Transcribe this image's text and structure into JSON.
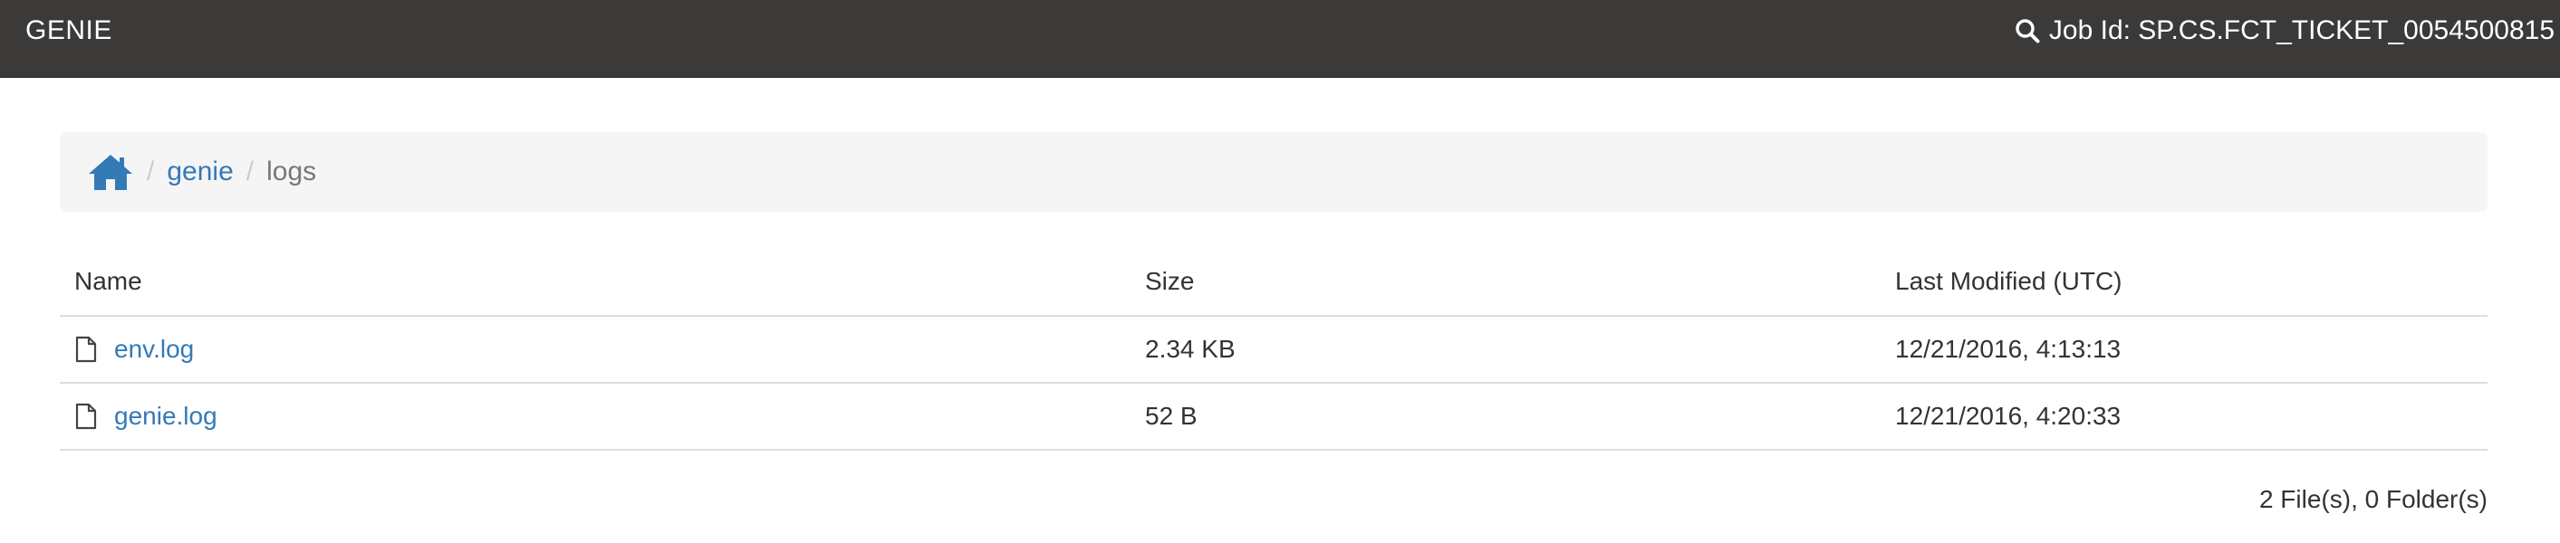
{
  "navbar": {
    "brand": "GENIE",
    "job_label": "Job Id: SP.CS.FCT_TICKET_0054500815",
    "search_icon": "search-icon"
  },
  "breadcrumb": {
    "home_icon": "home-icon",
    "separator": "/",
    "items": [
      {
        "label": "genie",
        "link": true
      },
      {
        "label": "logs",
        "link": false
      }
    ]
  },
  "table": {
    "columns": [
      "Name",
      "Size",
      "Last Modified (UTC)"
    ],
    "rows": [
      {
        "icon": "file-icon",
        "name": "env.log",
        "size": "2.34 KB",
        "modified": "12/21/2016, 4:13:13"
      },
      {
        "icon": "file-icon",
        "name": "genie.log",
        "size": "52 B",
        "modified": "12/21/2016, 4:20:33"
      }
    ]
  },
  "summary": "2 File(s), 0 Folder(s)",
  "colors": {
    "navbar_bg": "#3b3a39",
    "link": "#337ab7",
    "breadcrumb_bg": "#f5f5f5"
  }
}
